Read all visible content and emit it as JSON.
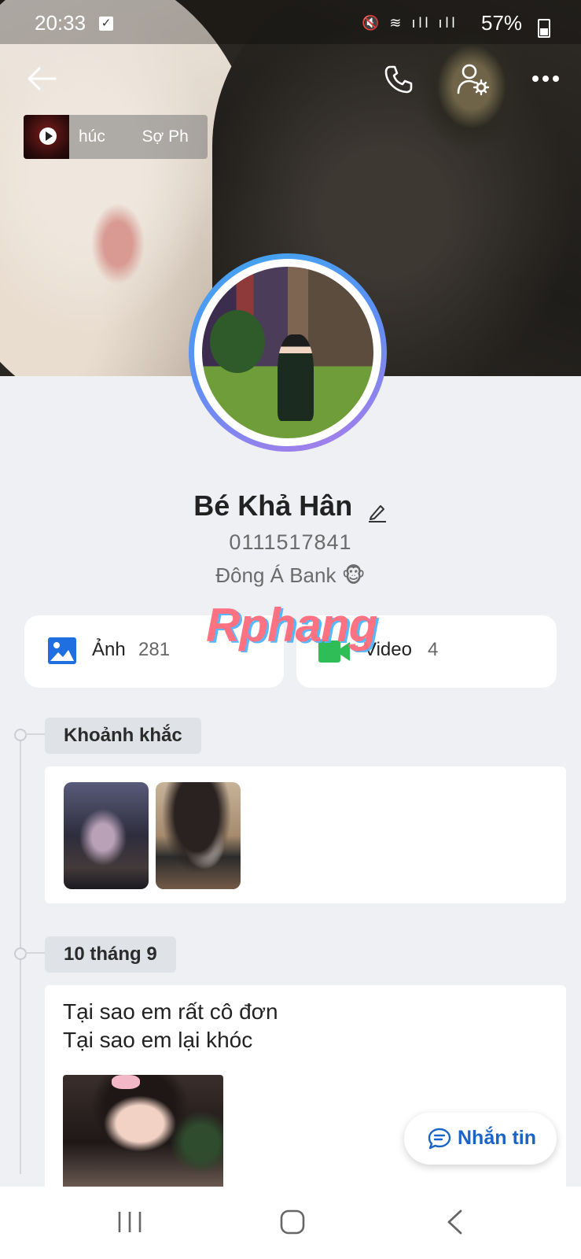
{
  "status_bar": {
    "time": "20:33",
    "battery": "57%"
  },
  "header": {
    "now_playing": "húc        Sợ Ph"
  },
  "profile": {
    "name": "Bé Khả Hân",
    "phone": "0111517841",
    "bio": "Đông Á Bank 🐵"
  },
  "media": {
    "photos_label": "Ảnh",
    "photos_count": "281",
    "videos_label": "Video",
    "videos_count": "4"
  },
  "watermark": "Rphang",
  "timeline": {
    "moments_label": "Khoảnh khắc",
    "post_date": "10 tháng 9",
    "post_line1": "Tại sao em rất cô đơn",
    "post_line2": "Tại sao em lại khóc"
  },
  "chat_button": {
    "label": "Nhắn tin"
  },
  "colors": {
    "accent": "#1a63c7",
    "background": "#eef0f3",
    "photo_icon": "#1f6fe0",
    "video_icon": "#2fbd57"
  },
  "icons": [
    "back-arrow-icon",
    "phone-call-icon",
    "user-settings-icon",
    "more-dots-icon",
    "pencil-icon",
    "image-icon",
    "video-camera-icon",
    "chat-bubble-icon",
    "recents-icon",
    "home-icon",
    "back-icon",
    "play-icon"
  ]
}
